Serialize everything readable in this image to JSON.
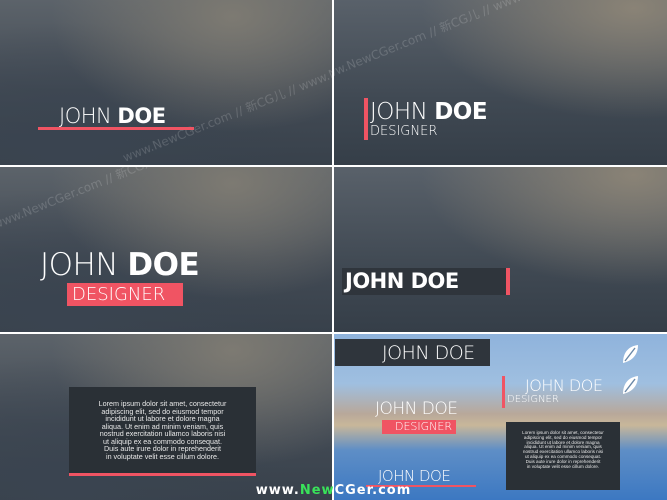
{
  "name_first": "JOHN",
  "name_last": "DOE",
  "name_full": "JOHN DOE",
  "role": "DESIGNER",
  "lorem_lines": [
    "Lorem ipsum dolor sit amet, consectetur",
    "adipiscing elit, sed do eiusmod tempor",
    "incididunt ut labore et dolore magna",
    "aliqua. Ut enim ad minim veniam, quis",
    "nostrud exercitation ullamco laboris nisi",
    "ut aliquip ex ea commodo consequat.",
    "Duis aute irure dolor in reprehenderit",
    "in voluptate velit esse cillum dolore."
  ],
  "watermark_text": "www.NewCGer.com // 新CG儿 // www.NewCGer.com // 新CG儿 //",
  "site": {
    "pre": "www.",
    "mid_a": "New",
    "mid_b": "CGer",
    "post": ".com"
  },
  "colors": {
    "accent": "#f05463",
    "text": "#ffffff",
    "panel": "#2f353c",
    "green": "#39e35a"
  }
}
